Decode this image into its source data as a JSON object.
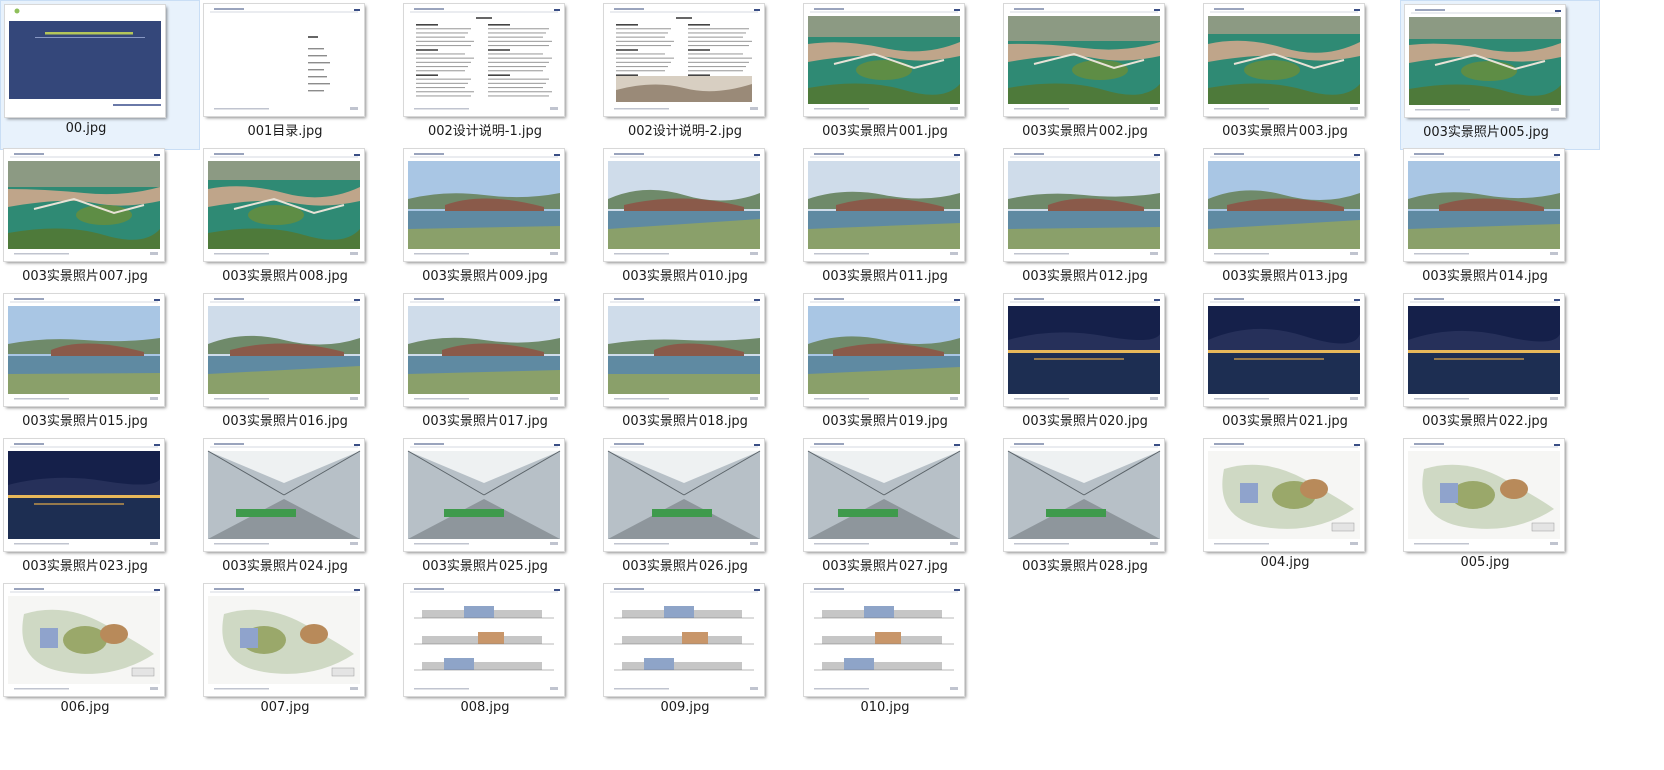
{
  "files": [
    {
      "name": "00.jpg",
      "kind": "cover",
      "selected": true
    },
    {
      "name": "001目录.jpg",
      "kind": "toc"
    },
    {
      "name": "002设计说明-1.jpg",
      "kind": "text"
    },
    {
      "name": "002设计说明-2.jpg",
      "kind": "text2"
    },
    {
      "name": "003实景照片001.jpg",
      "kind": "aerial"
    },
    {
      "name": "003实景照片002.jpg",
      "kind": "aerial"
    },
    {
      "name": "003实景照片003.jpg",
      "kind": "aerial"
    },
    {
      "name": "003实景照片005.jpg",
      "kind": "aerial",
      "selected": true
    },
    {
      "name": "003实景照片007.jpg",
      "kind": "aerial"
    },
    {
      "name": "003实景照片008.jpg",
      "kind": "aerial"
    },
    {
      "name": "003实景照片009.jpg",
      "kind": "photo"
    },
    {
      "name": "003实景照片010.jpg",
      "kind": "photo"
    },
    {
      "name": "003实景照片011.jpg",
      "kind": "photo"
    },
    {
      "name": "003实景照片012.jpg",
      "kind": "photo"
    },
    {
      "name": "003实景照片013.jpg",
      "kind": "photo"
    },
    {
      "name": "003实景照片014.jpg",
      "kind": "photo"
    },
    {
      "name": "003实景照片015.jpg",
      "kind": "photo"
    },
    {
      "name": "003实景照片016.jpg",
      "kind": "photo"
    },
    {
      "name": "003实景照片017.jpg",
      "kind": "photo"
    },
    {
      "name": "003实景照片018.jpg",
      "kind": "photo"
    },
    {
      "name": "003实景照片019.jpg",
      "kind": "photo"
    },
    {
      "name": "003实景照片020.jpg",
      "kind": "night"
    },
    {
      "name": "003实景照片021.jpg",
      "kind": "night"
    },
    {
      "name": "003实景照片022.jpg",
      "kind": "night"
    },
    {
      "name": "003实景照片023.jpg",
      "kind": "night"
    },
    {
      "name": "003实景照片024.jpg",
      "kind": "interior"
    },
    {
      "name": "003实景照片025.jpg",
      "kind": "interior"
    },
    {
      "name": "003实景照片026.jpg",
      "kind": "interior"
    },
    {
      "name": "003实景照片027.jpg",
      "kind": "interior"
    },
    {
      "name": "003实景照片028.jpg",
      "kind": "interior"
    },
    {
      "name": "004.jpg",
      "kind": "plan"
    },
    {
      "name": "005.jpg",
      "kind": "plan"
    },
    {
      "name": "006.jpg",
      "kind": "plan"
    },
    {
      "name": "007.jpg",
      "kind": "plan"
    },
    {
      "name": "008.jpg",
      "kind": "section"
    },
    {
      "name": "009.jpg",
      "kind": "section"
    },
    {
      "name": "010.jpg",
      "kind": "section"
    }
  ],
  "colors": {
    "selection_bg": "#e8f2fc",
    "selection_border": "#c9def5",
    "cover_blue": "#34477a"
  }
}
